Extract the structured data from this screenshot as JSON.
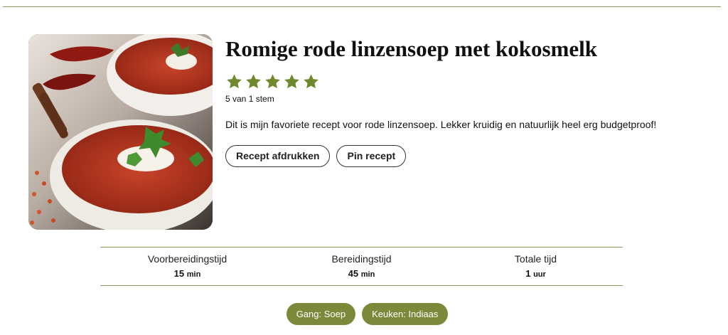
{
  "recipe": {
    "title": "Romige rode linzensoep met kokosmelk",
    "rating": {
      "stars": 5,
      "max": 5,
      "text": "5 van 1 stem",
      "color": "#6f8a2e"
    },
    "summary": "Dit is mijn favoriete recept voor rode linzensoep. Lekker kruidig en natuurlijk heel erg budgetproof!",
    "buttons": {
      "print_label": "Recept afdrukken",
      "pin_label": "Pin recept"
    },
    "times": [
      {
        "label": "Voorbereidingstijd",
        "value": "15",
        "unit": "min"
      },
      {
        "label": "Bereidingstijd",
        "value": "45",
        "unit": "min"
      },
      {
        "label": "Totale tijd",
        "value": "1",
        "unit": "uur"
      }
    ],
    "tags": [
      {
        "label": "Gang: Soep"
      },
      {
        "label": "Keuken: Indiaas"
      }
    ]
  },
  "colors": {
    "accent": "#7a8a3a",
    "rule": "#8a9a55"
  }
}
